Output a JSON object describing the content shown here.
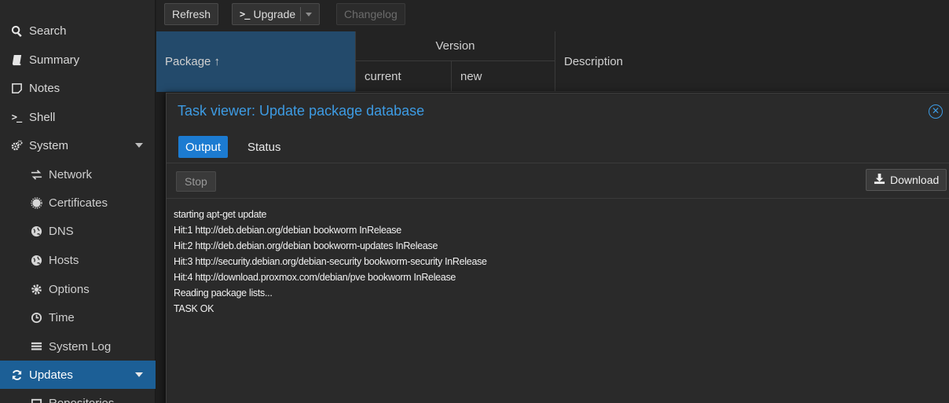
{
  "sidebar": {
    "items": [
      {
        "label": "Search",
        "icon": "search-icon",
        "level": "top"
      },
      {
        "label": "Summary",
        "icon": "book-icon",
        "level": "top"
      },
      {
        "label": "Notes",
        "icon": "note-icon",
        "level": "top"
      },
      {
        "label": "Shell",
        "icon": "terminal-icon",
        "level": "top"
      },
      {
        "label": "System",
        "icon": "gears-icon",
        "level": "top",
        "expandable": true
      },
      {
        "label": "Network",
        "icon": "exchange-icon",
        "level": "sub"
      },
      {
        "label": "Certificates",
        "icon": "certificate-icon",
        "level": "sub"
      },
      {
        "label": "DNS",
        "icon": "globe-icon",
        "level": "sub"
      },
      {
        "label": "Hosts",
        "icon": "globe-icon",
        "level": "sub"
      },
      {
        "label": "Options",
        "icon": "gear-icon",
        "level": "sub"
      },
      {
        "label": "Time",
        "icon": "clock-icon",
        "level": "sub"
      },
      {
        "label": "System Log",
        "icon": "list-icon",
        "level": "sub"
      },
      {
        "label": "Updates",
        "icon": "refresh-icon",
        "level": "top",
        "expandable": true,
        "active": true
      },
      {
        "label": "Repositories",
        "icon": "repositories-icon",
        "level": "sub"
      }
    ]
  },
  "toolbar": {
    "refresh_label": "Refresh",
    "upgrade_label": "Upgrade",
    "upgrade_prefix": ">_",
    "changelog_label": "Changelog"
  },
  "grid": {
    "col_package": "Package ↑",
    "col_version": "Version",
    "col_current": "current",
    "col_new": "new",
    "col_description": "Description"
  },
  "task_viewer": {
    "title": "Task viewer: Update package database",
    "close_glyph": "✕",
    "tabs": [
      {
        "label": "Output",
        "active": true
      },
      {
        "label": "Status",
        "active": false
      }
    ],
    "stop_label": "Stop",
    "download_label": "Download",
    "log": [
      "starting apt-get update",
      "Hit:1 http://deb.debian.org/debian bookworm InRelease",
      "Hit:2 http://deb.debian.org/debian bookworm-updates InRelease",
      "Hit:3 http://security.debian.org/debian-security bookworm-security InRelease",
      "Hit:4 http://download.proxmox.com/debian/pve bookworm InRelease",
      "Reading package lists...",
      "TASK OK"
    ]
  },
  "colors": {
    "accent": "#1c7bd1",
    "active_nav": "#1c5f96",
    "title_blue": "#3d9be3",
    "sorted_header": "#234a6b"
  }
}
